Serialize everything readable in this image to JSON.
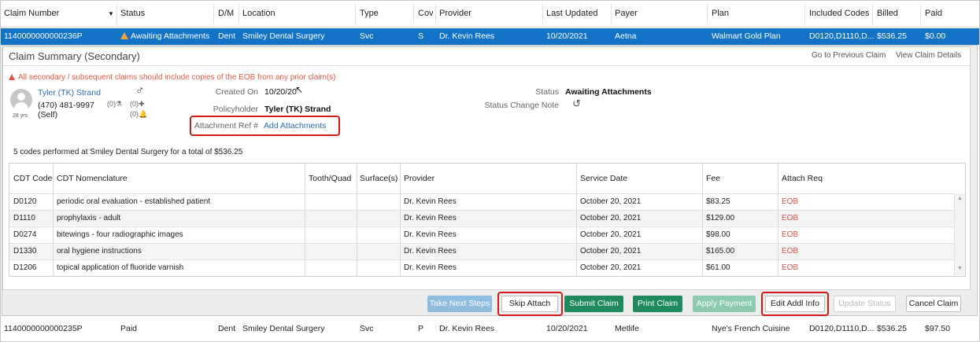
{
  "grid": {
    "columns": [
      "Claim Number",
      "Status",
      "D/M",
      "Location",
      "Type",
      "Cov",
      "Provider",
      "Last Updated",
      "Payer",
      "Plan",
      "Included Codes",
      "Billed",
      "Paid"
    ],
    "selected_row": {
      "claim_number": "1140000000000236P",
      "status": "Awaiting Attachments",
      "dm": "Dent",
      "location": "Smiley Dental Surgery",
      "type": "Svc",
      "cov": "S",
      "provider": "Dr. Kevin Rees",
      "last_updated": "10/20/2021",
      "payer": "Aetna",
      "plan": "Walmart Gold Plan",
      "included_codes": "D0120,D1110,D...",
      "billed": "$536.25",
      "paid": "$0.00"
    },
    "next_row": {
      "claim_number": "1140000000000235P",
      "status": "Paid",
      "dm": "Dent",
      "location": "Smiley Dental Surgery",
      "type": "Svc",
      "cov": "P",
      "provider": "Dr. Kevin Rees",
      "last_updated": "10/20/2021",
      "payer": "Metlife",
      "plan": "Nye's French Cuisine",
      "included_codes": "D0120,D1110,D...",
      "billed": "$536.25",
      "paid": "$97.50"
    }
  },
  "summary": {
    "title": "Claim Summary (Secondary)",
    "go_previous": "Go to Previous Claim",
    "view_details": "View Claim Details",
    "warning": "All secondary / subsequent claims should include copies of the EOB from any prior claim(s)",
    "patient": {
      "name": "Tyler (TK) Strand",
      "phone": "(470) 481-9997",
      "relation": "(Self)",
      "age": "28 yrs",
      "count1": "(0)",
      "count2": "(0)",
      "count3": "(0)"
    },
    "created_on_label": "Created On",
    "created_on": "10/20/20",
    "policyholder_label": "Policyholder",
    "policyholder": "Tyler (TK) Strand",
    "attach_ref_label": "Attachment Ref #",
    "add_attachments": "Add Attachments",
    "status_label": "Status",
    "status": "Awaiting Attachments",
    "status_change_label": "Status Change Note",
    "codes_summary": "5 codes performed at Smiley Dental Surgery for a total of $536.25"
  },
  "codes": {
    "headers": [
      "CDT Code",
      "CDT Nomenclature",
      "Tooth/Quad",
      "Surface(s)",
      "Provider",
      "Service Date",
      "Fee",
      "Attach Req"
    ],
    "rows": [
      {
        "code": "D0120",
        "desc": "periodic oral evaluation - established patient",
        "provider": "Dr. Kevin Rees",
        "date": "October 20, 2021",
        "fee": "$83.25",
        "attach": "EOB"
      },
      {
        "code": "D1110",
        "desc": "prophylaxis - adult",
        "provider": "Dr. Kevin Rees",
        "date": "October 20, 2021",
        "fee": "$129.00",
        "attach": "EOB"
      },
      {
        "code": "D0274",
        "desc": "bitewings - four radiographic images",
        "provider": "Dr. Kevin Rees",
        "date": "October 20, 2021",
        "fee": "$98.00",
        "attach": "EOB"
      },
      {
        "code": "D1330",
        "desc": "oral hygiene instructions",
        "provider": "Dr. Kevin Rees",
        "date": "October 20, 2021",
        "fee": "$165.00",
        "attach": "EOB"
      },
      {
        "code": "D1206",
        "desc": "topical application of fluoride varnish",
        "provider": "Dr. Kevin Rees",
        "date": "October 20, 2021",
        "fee": "$61.00",
        "attach": "EOB"
      }
    ]
  },
  "buttons": {
    "take_next_steps": "Take Next Steps",
    "skip_attach": "Skip Attach",
    "submit_claim": "Submit Claim",
    "print_claim": "Print Claim",
    "apply_payment": "Apply Payment",
    "edit_addl_info": "Edit Addl Info",
    "update_status": "Update Status",
    "cancel_claim": "Cancel Claim"
  },
  "colors": {
    "selected_row": "#1373c7",
    "link": "#2f6fb0",
    "warning": "#e05a4a",
    "green_button": "#1f8a5d",
    "highlight_box": "#d11a1a"
  }
}
